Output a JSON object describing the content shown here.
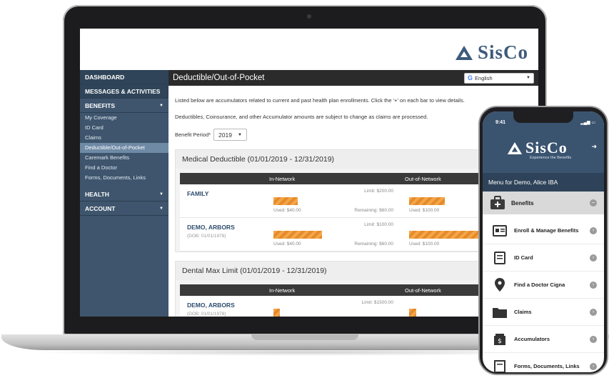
{
  "brand": {
    "logo_text": "SisCo",
    "mobile_tagline": "Experience the Benefits"
  },
  "sidebar": {
    "dashboard": "DASHBOARD",
    "messages": "MESSAGES & ACTIVITIES",
    "benefits": "BENEFITS",
    "benefit_items": [
      "My Coverage",
      "ID Card",
      "Claims",
      "Deductible/Out-of-Pocket",
      "Caremark Benefits",
      "Find a Doctor",
      "Forms, Documents, Links"
    ],
    "health": "HEALTH",
    "account": "ACCOUNT"
  },
  "main": {
    "title": "Deductible/Out-of-Pocket",
    "language": "English",
    "info1": "Listed below are accumulators related to current and past health plan enrollments. Click the '+' on each bar to view details.",
    "info2": "Deductibles, Coinsurance, and other Accumulator amounts are subject to change as claims are processed.",
    "period_label": "Benefit Period*",
    "period_value": "2019"
  },
  "medical": {
    "title": "Medical Deductible (01/01/2019 - 12/31/2019)",
    "in_network": "In-Network",
    "out_network": "Out-of-Network",
    "rows": [
      {
        "name": "FAMILY",
        "dob": "",
        "limit": "Limit: $200.00",
        "used": "Used: $40.00",
        "remaining": "Remaining: $60.00",
        "oon_used": "Used: $100.00",
        "in_fill": 0.2,
        "oon_fill": 0.5
      },
      {
        "name": "DEMO, ARBORS",
        "dob": "(DOB: 01/01/1978)",
        "limit": "Limit: $100.00",
        "used": "Used: $40.00",
        "remaining": "Remaining: $60.00",
        "oon_used": "Used: $100.00",
        "in_fill": 0.4,
        "oon_fill": 1.0
      }
    ]
  },
  "dental": {
    "title": "Dental Max Limit (01/01/2019 - 12/31/2019)",
    "in_network": "In-Network",
    "out_network": "Out-of-Network",
    "name": "DEMO, ARBORS",
    "dob": "(DOB: 01/01/1978)",
    "limit": "Limit: $1500.00",
    "in_fill": 0.05,
    "oon_fill": 0.1
  },
  "phone": {
    "time": "9:41",
    "menu_for": "Menu for Demo, Alice IBA",
    "section": "Benefits",
    "items": [
      "Enroll & Manage Benefits",
      "ID Card",
      "Find a Doctor Cigna",
      "Claims",
      "Accumulators",
      "Forms, Documents, Links"
    ]
  },
  "colors": {
    "navy": "#3e556d",
    "accent_orange": "#f2a649",
    "dark_bar": "#2b2b2b"
  }
}
